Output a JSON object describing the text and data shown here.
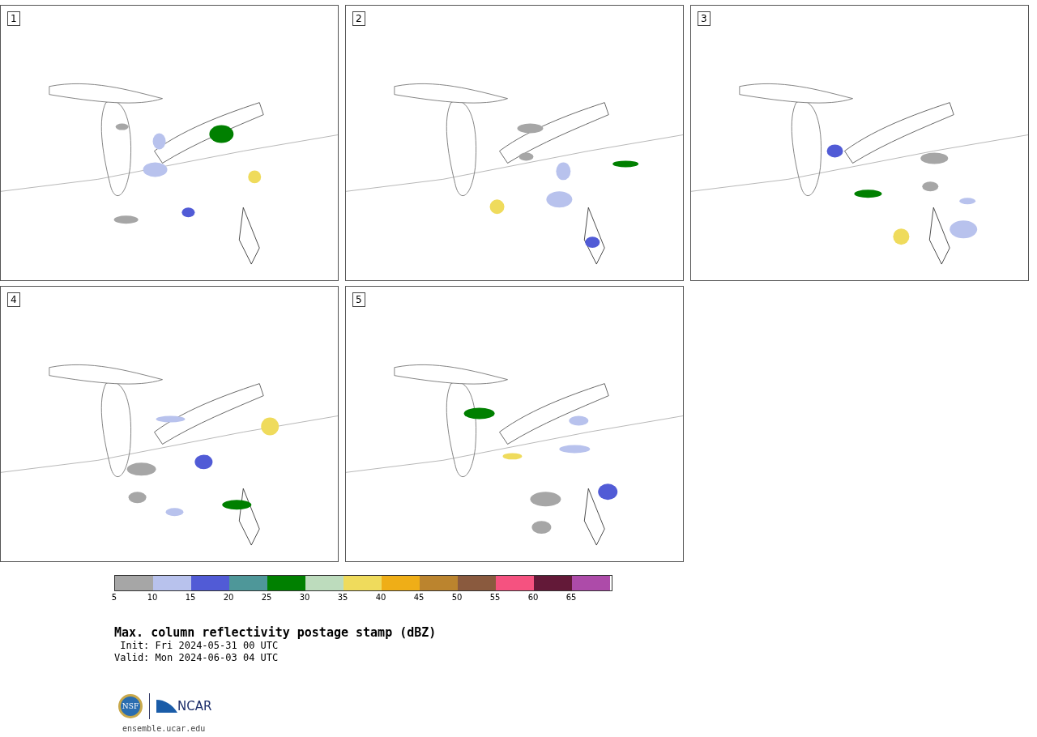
{
  "panels": [
    {
      "number": "1"
    },
    {
      "number": "2"
    },
    {
      "number": "3"
    },
    {
      "number": "4"
    },
    {
      "number": "5"
    }
  ],
  "legend": {
    "segments": [
      {
        "color": "#a6a6a6"
      },
      {
        "color": "#b8c2ed"
      },
      {
        "color": "#515bd6"
      },
      {
        "color": "#4e9799"
      },
      {
        "color": "#008000"
      },
      {
        "color": "#bddcbd"
      },
      {
        "color": "#efdb5c"
      },
      {
        "color": "#efae17"
      },
      {
        "color": "#bb842e"
      },
      {
        "color": "#8a5a3e"
      },
      {
        "color": "#f55280"
      },
      {
        "color": "#631938"
      },
      {
        "color": "#ad4ba9"
      }
    ],
    "ticks": [
      "5",
      "10",
      "15",
      "20",
      "25",
      "30",
      "35",
      "40",
      "45",
      "50",
      "55",
      "60",
      "65"
    ]
  },
  "title": "Max. column reflectivity postage stamp (dBZ)",
  "init": " Init: Fri 2024-05-31 00 UTC",
  "valid": "Valid: Mon 2024-06-03 04 UTC",
  "logo": {
    "left": "NSF",
    "right": "NCAR"
  },
  "site": "ensemble.ucar.edu"
}
